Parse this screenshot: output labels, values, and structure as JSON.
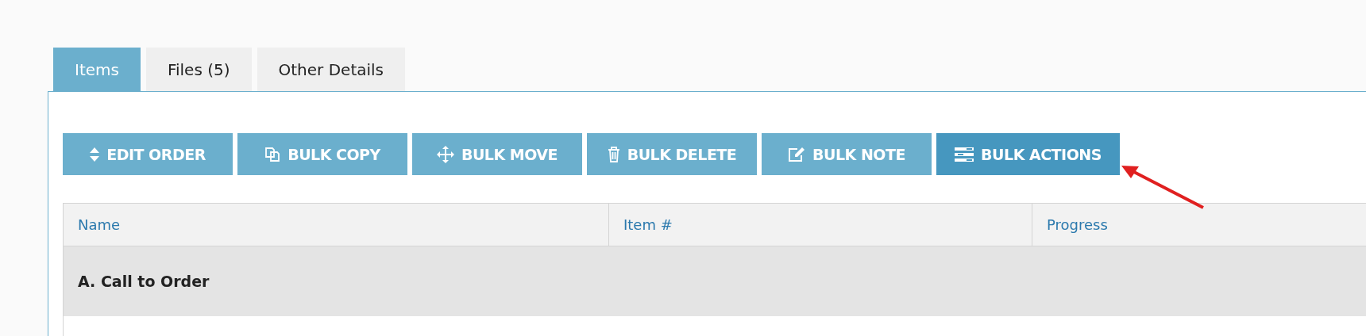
{
  "tabs": [
    {
      "label": "Items",
      "selected": true
    },
    {
      "label": "Files (5)",
      "selected": false
    },
    {
      "label": "Other Details",
      "selected": false
    }
  ],
  "toolbar": [
    {
      "label": "EDIT ORDER",
      "kind": "sort",
      "active": false
    },
    {
      "label": "BULK COPY",
      "kind": "copy",
      "active": false
    },
    {
      "label": "BULK MOVE",
      "kind": "move",
      "active": false
    },
    {
      "label": "BULK DELETE",
      "kind": "trash",
      "active": false
    },
    {
      "label": "BULK NOTE",
      "kind": "edit",
      "active": false
    },
    {
      "label": "BULK ACTIONS",
      "kind": "list",
      "active": true
    }
  ],
  "table": {
    "columns": [
      "Name",
      "Item #",
      "Progress"
    ],
    "rows": [
      {
        "kind": "section",
        "label": "A. Call to Order"
      }
    ]
  }
}
